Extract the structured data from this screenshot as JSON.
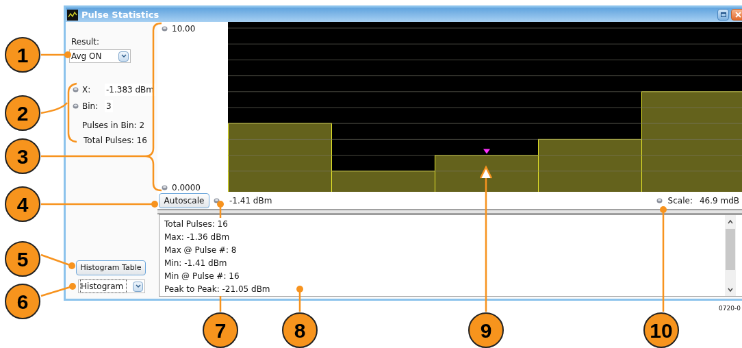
{
  "window": {
    "title": "Pulse Statistics"
  },
  "controls": {
    "result_label": "Result:",
    "result_value": "Avg ON",
    "readouts": [
      {
        "label": "X:",
        "value": "-1.383 dBm"
      },
      {
        "label": "Bin:",
        "value": "3"
      }
    ],
    "pulses_in_bin": "Pulses in Bin: 2",
    "total_pulses": "Total Pulses: 16",
    "table_button": "Histogram Table",
    "view_value": "Histogram"
  },
  "chart": {
    "chart_data": {
      "type": "bar",
      "values": [
        4,
        1,
        2,
        3,
        6
      ],
      "ylim": [
        0,
        10
      ],
      "yticks": [
        {
          "value": 10,
          "label": "10.00"
        },
        {
          "value": 0,
          "label": "0.0000"
        }
      ]
    },
    "bins": [
      {
        "selected": false
      },
      {
        "selected": false
      },
      {
        "selected": true
      },
      {
        "selected": false
      },
      {
        "selected": false
      }
    ]
  },
  "toolbar": {
    "autoscale": "Autoscale",
    "marker_reading": "-1.41 dBm",
    "scale_label": "Scale:",
    "scale_value": "46.9 mdB"
  },
  "statistics": [
    "Total Pulses: 16",
    "Max: -1.36 dBm",
    "Max @ Pulse #: 8",
    "Min: -1.41 dBm",
    "Min @ Pulse #: 16",
    "Peak to Peak: -21.05 dBm"
  ],
  "figure_id": "0720-0",
  "callouts": [
    "1",
    "2",
    "3",
    "4",
    "5",
    "6",
    "7",
    "8",
    "9",
    "10"
  ]
}
